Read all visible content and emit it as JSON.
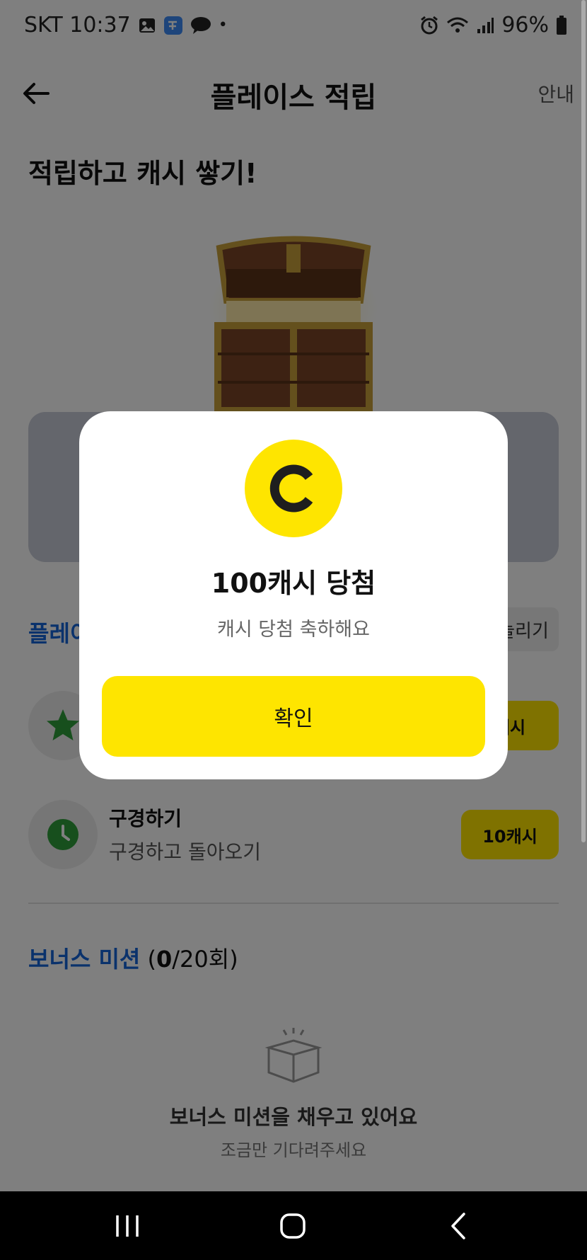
{
  "status_bar": {
    "carrier_time": "SKT 10:37",
    "dot": "•",
    "battery": "96%"
  },
  "header": {
    "title": "플레이스 적립",
    "info_label": "안내"
  },
  "headline": "적립하고 캐시 쌓기!",
  "section": {
    "partial_title": "플레이",
    "partial_button": "늘리기"
  },
  "missions": [
    {
      "title": "",
      "subtitle": "",
      "reward": "캐시",
      "icon": "star-icon"
    },
    {
      "title": "구경하기",
      "subtitle": "구경하고 돌아오기",
      "reward": "10캐시",
      "icon": "clock-icon"
    }
  ],
  "bonus": {
    "title": "보너스 미션",
    "count_open": "(",
    "count_done": "0",
    "count_total": "/20회)",
    "empty_title": "보너스 미션을 채우고 있어요",
    "empty_sub": "조금만 기다려주세요"
  },
  "dialog": {
    "title": "100캐시 당첨",
    "subtitle": "캐시 당첨 축하해요",
    "confirm_label": "확인"
  },
  "colors": {
    "accent_yellow": "#fee500",
    "link_blue": "#1565d8",
    "mission_icon_green": "#2e9e3a"
  }
}
